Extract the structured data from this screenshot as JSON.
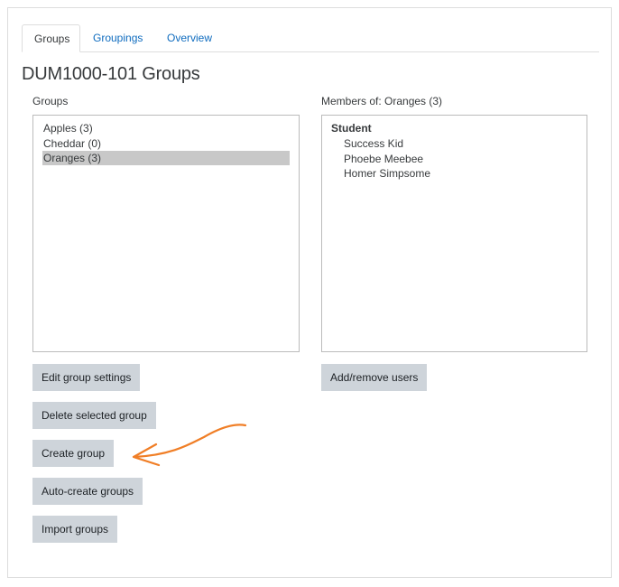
{
  "tabs": [
    {
      "label": "Groups",
      "active": true
    },
    {
      "label": "Groupings",
      "active": false
    },
    {
      "label": "Overview",
      "active": false
    }
  ],
  "page_title": "DUM1000-101 Groups",
  "groups_panel": {
    "label": "Groups",
    "items": [
      {
        "label": "Apples (3)",
        "selected": false
      },
      {
        "label": "Cheddar (0)",
        "selected": false
      },
      {
        "label": "Oranges (3)",
        "selected": true
      }
    ]
  },
  "members_panel": {
    "label": "Members of: Oranges (3)",
    "role": "Student",
    "members": [
      "Success Kid",
      "Phoebe Meebee",
      "Homer Simpsome"
    ]
  },
  "buttons": {
    "edit_group_settings": "Edit group settings",
    "delete_selected_group": "Delete selected group",
    "create_group": "Create group",
    "auto_create_groups": "Auto-create groups",
    "import_groups": "Import groups",
    "add_remove_users": "Add/remove users"
  },
  "colors": {
    "link": "#0f6cbf",
    "button_bg": "#ced4da",
    "selected_bg": "#c8c8c8",
    "annotation_arrow": "#f07e26"
  }
}
